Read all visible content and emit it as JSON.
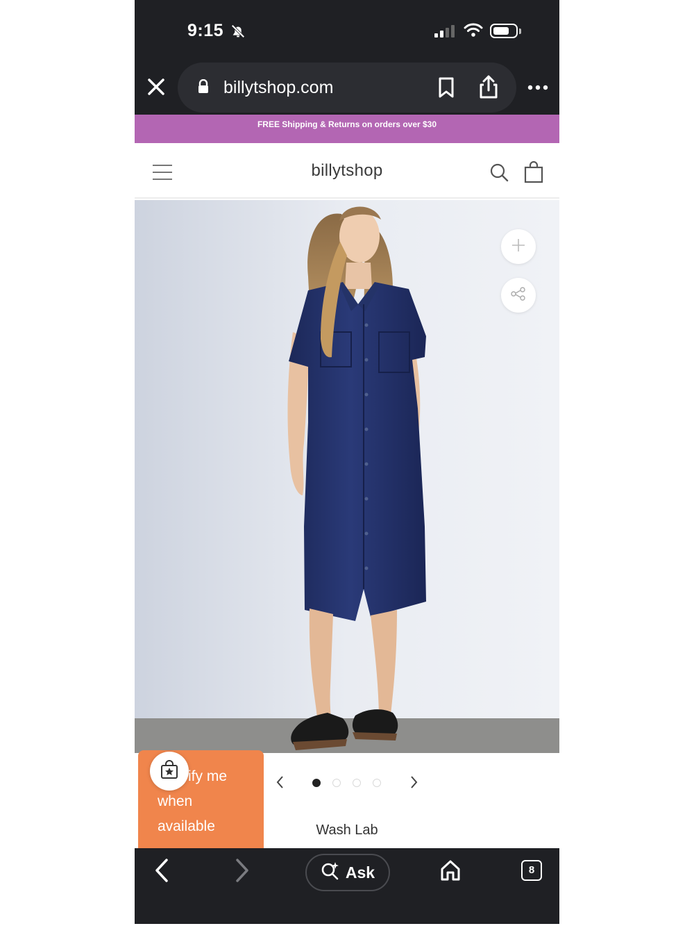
{
  "status_bar": {
    "time": "9:15",
    "icons": [
      "bell-slash-icon",
      "cellular-signal-icon",
      "wifi-icon",
      "battery-icon"
    ],
    "battery_level": 0.7
  },
  "browser": {
    "url": "billytshop.com",
    "icons": [
      "close-icon",
      "lock-icon",
      "bookmark-icon",
      "share-icon",
      "more-icon"
    ]
  },
  "promo_banner": {
    "text": "FREE Shipping & Returns on orders over $30",
    "color": "#b366b3"
  },
  "site_header": {
    "logo": "billytshop",
    "icons": [
      "menu-icon",
      "search-icon",
      "shopping-bag-icon"
    ]
  },
  "product": {
    "image_icons": [
      "plus-icon",
      "share-nodes-icon"
    ],
    "carousel": {
      "total": 4,
      "active_index": 1
    },
    "brand": "Wash Lab"
  },
  "notify_card": {
    "text_line1": "ify me",
    "text_line2": "when",
    "text_line3": "available",
    "color": "#f0854c",
    "icon": "shopping-bag-star-icon"
  },
  "bottom_bar": {
    "ask_label": "Ask",
    "tab_count": "8",
    "icons": [
      "back-icon",
      "forward-icon",
      "ask-sparkle-icon",
      "home-icon",
      "tabs-icon"
    ]
  }
}
